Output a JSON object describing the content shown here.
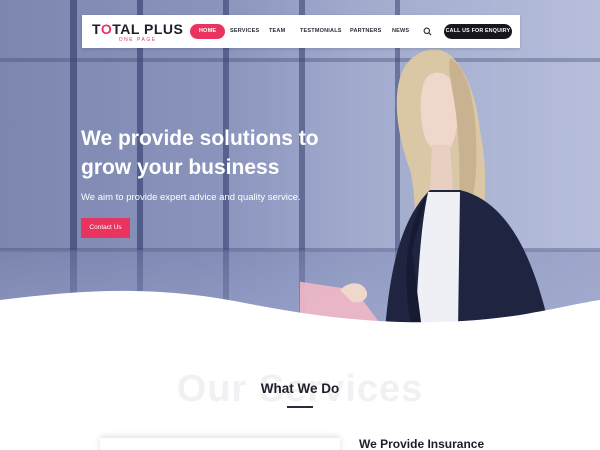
{
  "logo": {
    "main_prefix": "T",
    "main_o": "O",
    "main_suffix": "TAL PLUS",
    "sub": "ONE PAGE"
  },
  "nav": {
    "items": [
      {
        "label": "HOME",
        "active": true
      },
      {
        "label": "SERVICES",
        "active": false
      },
      {
        "label": "TEAM",
        "active": false
      },
      {
        "label": "TESTMONIALS",
        "active": false
      },
      {
        "label": "PARTNERS",
        "active": false
      },
      {
        "label": "NEWS",
        "active": false
      }
    ],
    "search_icon": "search-icon",
    "cta_label": "CALL US FOR ENQUIRY"
  },
  "hero": {
    "headline": "We provide solutions to grow your business",
    "subline": "We aim to provide expert advice and quality service.",
    "button_label": "Contact Us"
  },
  "services": {
    "background_word": "Our Services",
    "title": "What We Do",
    "feature_title": "We Provide Insurance"
  },
  "colors": {
    "accent": "#e8345e",
    "dark": "#16161e",
    "hero_tint": "#6b76a6"
  }
}
